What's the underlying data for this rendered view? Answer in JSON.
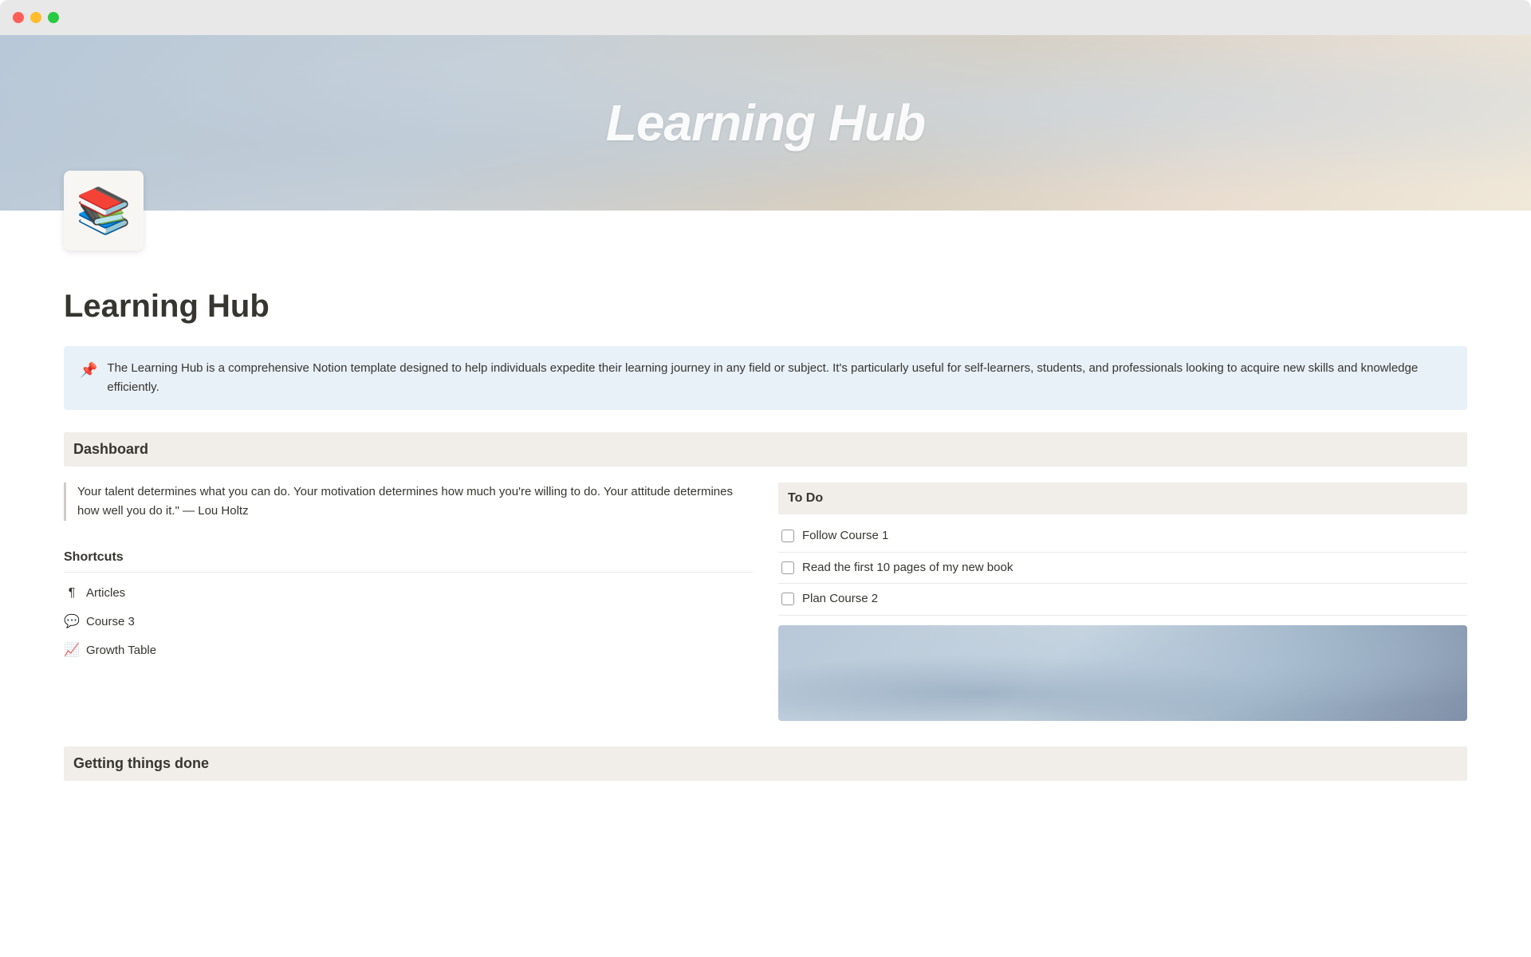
{
  "window": {
    "traffic_lights": [
      "red",
      "yellow",
      "green"
    ]
  },
  "hero": {
    "title": "Learning Hub",
    "background_colors": [
      "#b8c8d8",
      "#d8cfc0",
      "#f0e8d8"
    ]
  },
  "page": {
    "icon": "📚",
    "title": "Learning Hub",
    "callout": {
      "icon": "📌",
      "text": "The Learning Hub is a comprehensive Notion template designed to help individuals expedite their learning journey in any field or subject. It's particularly useful for self-learners, students, and professionals looking to acquire new skills and knowledge efficiently."
    }
  },
  "dashboard": {
    "section_label": "Dashboard",
    "quote": "Your talent determines what you can do. Your motivation determines how much you're willing to do. Your attitude determines how well you do it.\" — Lou Holtz",
    "shortcuts": {
      "title": "Shortcuts",
      "items": [
        {
          "icon": "¶",
          "label": "Articles"
        },
        {
          "icon": "💬",
          "label": "Course 3"
        },
        {
          "icon": "📈",
          "label": "Growth Table"
        }
      ]
    },
    "todo": {
      "title": "To Do",
      "items": [
        {
          "label": "Follow Course 1",
          "checked": false
        },
        {
          "label": "Read the first 10 pages of my new book",
          "checked": false
        },
        {
          "label": "Plan Course 2",
          "checked": false
        }
      ]
    }
  },
  "getting_done": {
    "section_label": "Getting things done"
  }
}
